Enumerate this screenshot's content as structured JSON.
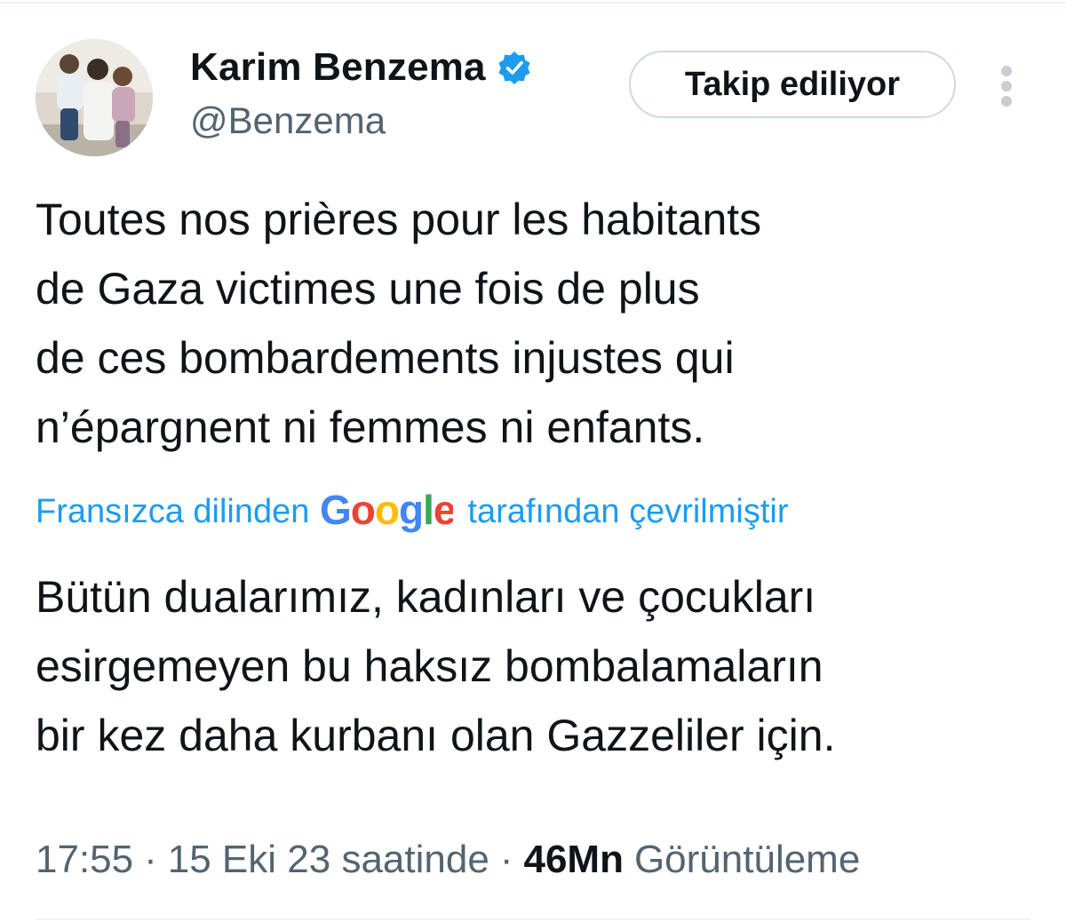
{
  "author": {
    "display_name": "Karim Benzema",
    "handle": "@Benzema",
    "verified": true
  },
  "follow_button": {
    "label": "Takip ediliyor"
  },
  "tweet": {
    "original_text": "Toutes nos prières pour les habitants\nde Gaza victimes une fois de plus\nde ces bombardements injustes qui\nn’épargnent ni femmes ni enfants.",
    "translation_note": {
      "prefix": "Fransızca dilinden",
      "provider": "Google",
      "suffix": "tarafından çevrilmiştir"
    },
    "translated_text": "Bütün dualarımız, kadınları ve çocukları\nesirgemeyen bu haksız bombalamaların\nbir kez daha kurbanı olan Gazzeliler için."
  },
  "meta": {
    "time": "17:55",
    "separator": "·",
    "date": "15 Eki 23 saatinde",
    "views_count": "46Mn",
    "views_label": "Görüntüleme"
  },
  "colors": {
    "text_primary": "#0f1419",
    "text_secondary": "#536471",
    "link_blue": "#1d9bf0",
    "verified_blue": "#1d9bf0",
    "border": "#cfd9de",
    "google_blue": "#4285f4",
    "google_red": "#ea4335",
    "google_yellow": "#fbbc05",
    "google_green": "#34a853"
  },
  "icons": {
    "verified": "verified-badge-icon",
    "more": "more-vertical-icon",
    "google_logo": "google-logo"
  }
}
